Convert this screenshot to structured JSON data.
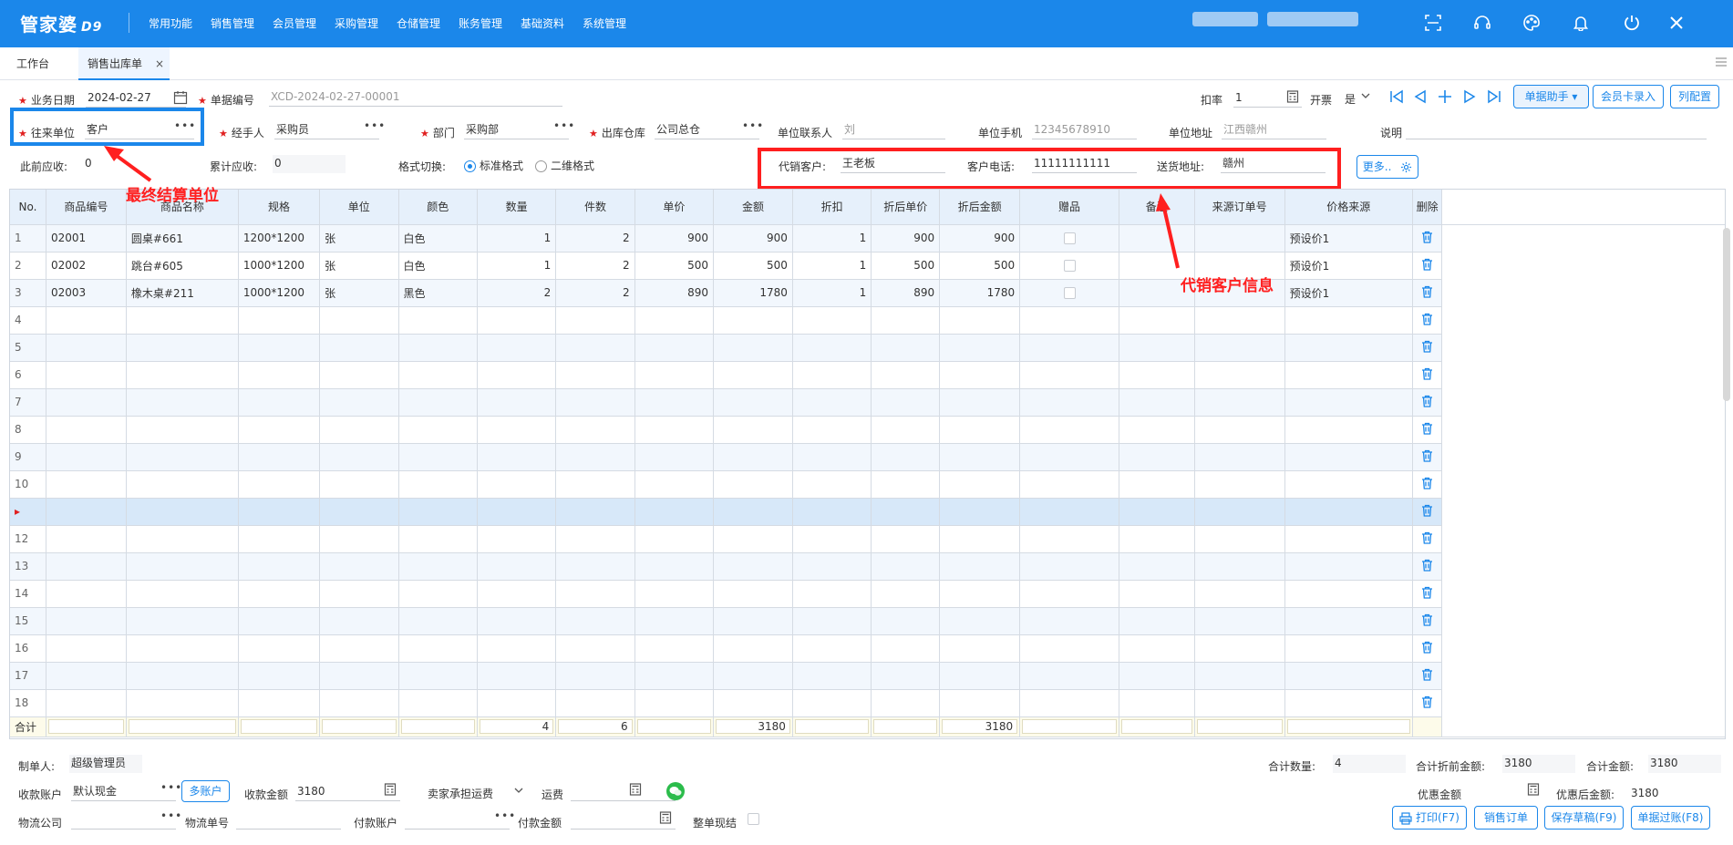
{
  "app": {
    "logo": "管家婆",
    "version": "D9"
  },
  "menu": [
    "常用功能",
    "销售管理",
    "会员管理",
    "采购管理",
    "仓储管理",
    "账务管理",
    "基础资料",
    "系统管理"
  ],
  "tabs": [
    {
      "label": "工作台"
    },
    {
      "label": "销售出库单",
      "close": "×"
    }
  ],
  "header": {
    "biz_date_label": "业务日期",
    "biz_date": "2024-02-27",
    "doc_no_label": "单据编号",
    "doc_no": "XCD-2024-02-27-00001",
    "discount_label": "扣率",
    "discount": "1",
    "invoice_label": "开票",
    "invoice": "是",
    "assistant_btn": "单据助手 ▾",
    "member_btn": "会员卡录入",
    "column_btn": "列配置",
    "partner_label": "往来单位",
    "partner": "客户",
    "handler_label": "经手人",
    "handler": "采购员",
    "dept_label": "部门",
    "dept": "采购部",
    "warehouse_label": "出库仓库",
    "warehouse": "公司总仓",
    "contact_label": "单位联系人",
    "contact": "刘",
    "mobile_label": "单位手机",
    "mobile": "12345678910",
    "address_label": "单位地址",
    "address": "江西赣州",
    "memo_label": "说明",
    "prev_recv_label": "此前应收:",
    "prev_recv": "0",
    "total_recv_label": "累计应收:",
    "total_recv": "0",
    "format_label": "格式切换:",
    "format_std": "标准格式",
    "format_2d": "二维格式",
    "agent_label": "代销客户:",
    "agent": "王老板",
    "cust_phone_label": "客户电话:",
    "cust_phone": "11111111111",
    "ship_addr_label": "送货地址:",
    "ship_addr": "赣州",
    "more_btn": "更多.."
  },
  "annotations": {
    "partner_note": "最终结算单位",
    "agent_note": "代销客户信息"
  },
  "table": {
    "columns": [
      "No.",
      "商品编号",
      "商品名称",
      "规格",
      "单位",
      "颜色",
      "数量",
      "件数",
      "单价",
      "金额",
      "折扣",
      "折后单价",
      "折后金额",
      "赠品",
      "备注",
      "来源订单号",
      "价格来源",
      "删除"
    ],
    "rows": [
      {
        "no": "1",
        "code": "02001",
        "name": "圆桌#661",
        "spec": "1200*1200",
        "unit": "张",
        "color": "白色",
        "qty": "1",
        "pcs": "2",
        "price": "900",
        "amount": "900",
        "disc": "1",
        "dprice": "900",
        "damount": "900",
        "src": "预设价1"
      },
      {
        "no": "2",
        "code": "02002",
        "name": "跳台#605",
        "spec": "1000*1200",
        "unit": "张",
        "color": "白色",
        "qty": "1",
        "pcs": "2",
        "price": "500",
        "amount": "500",
        "disc": "1",
        "dprice": "500",
        "damount": "500",
        "src": "预设价1"
      },
      {
        "no": "3",
        "code": "02003",
        "name": "橡木桌#211",
        "spec": "1000*1200",
        "unit": "张",
        "color": "黑色",
        "qty": "2",
        "pcs": "2",
        "price": "890",
        "amount": "1780",
        "disc": "1",
        "dprice": "890",
        "damount": "1780",
        "src": "预设价1"
      }
    ],
    "empty_rows": [
      "4",
      "5",
      "6",
      "7",
      "8",
      "9",
      "10",
      "▸",
      "12",
      "13",
      "14",
      "15",
      "16",
      "17",
      "18"
    ],
    "sum_label": "合计",
    "sum_qty": "4",
    "sum_pcs": "6",
    "sum_amount": "3180",
    "sum_damount": "3180"
  },
  "footer": {
    "maker_label": "制单人:",
    "maker": "超级管理员",
    "total_qty_label": "合计数量:",
    "total_qty": "4",
    "pre_disc_label": "合计折前金额:",
    "pre_disc": "3180",
    "total_amt_label": "合计金额:",
    "total_amt": "3180",
    "account_label": "收款账户",
    "account": "默认现金",
    "multi_btn": "多账户",
    "recv_amt_label": "收款金额",
    "recv_amt": "3180",
    "freight_opt": "卖家承担运费",
    "freight_label": "运费",
    "discount_amt_label": "优惠金额",
    "after_disc_label": "优惠后金额:",
    "after_disc": "3180",
    "logistics_label": "物流公司",
    "logistics_no_label": "物流单号",
    "pay_account_label": "付款账户",
    "pay_amt_label": "付款金额",
    "whole_label": "整单现结",
    "print_btn": "打印(F7)",
    "order_btn": "销售订单",
    "draft_btn": "保存草稿(F9)",
    "post_btn": "单据过账(F8)"
  },
  "colors": {
    "brand": "#1b87ea",
    "annotation": "#ff1f1f"
  }
}
